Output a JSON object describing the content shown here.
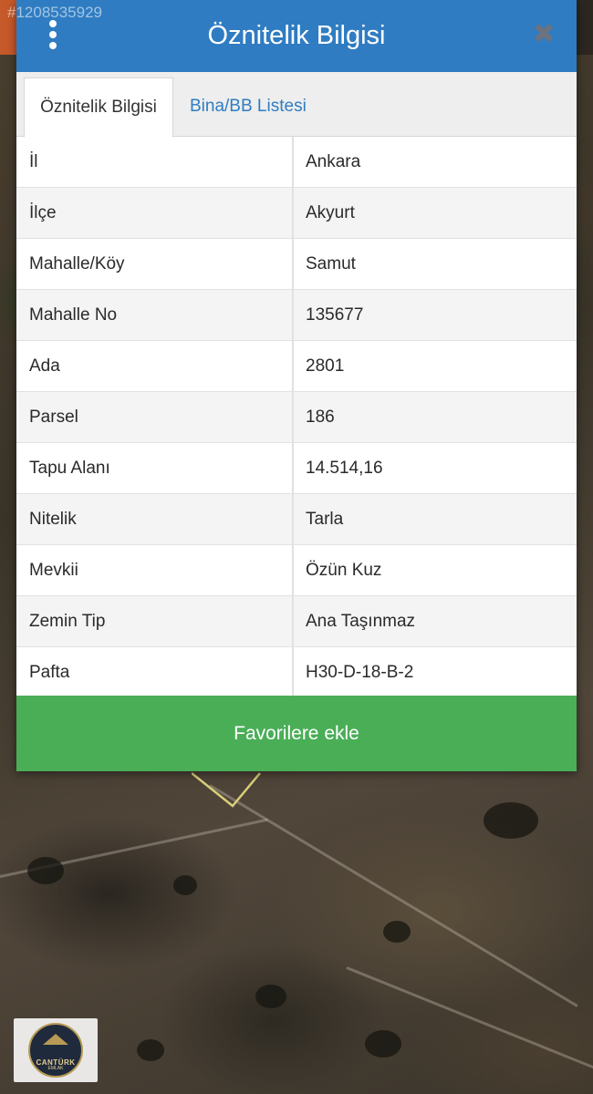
{
  "watermark": "#1208535929",
  "dialog": {
    "title": "Öznitelik Bilgisi",
    "menu_icon": "vertical-dots-icon",
    "close_icon": "close-icon"
  },
  "tabs": [
    {
      "label": "Öznitelik Bilgisi",
      "active": true
    },
    {
      "label": "Bina/BB Listesi",
      "active": false
    }
  ],
  "attributes": [
    {
      "key": "İl",
      "value": "Ankara"
    },
    {
      "key": "İlçe",
      "value": "Akyurt"
    },
    {
      "key": "Mahalle/Köy",
      "value": "Samut"
    },
    {
      "key": "Mahalle No",
      "value": "135677"
    },
    {
      "key": "Ada",
      "value": "2801"
    },
    {
      "key": "Parsel",
      "value": "186"
    },
    {
      "key": "Tapu Alanı",
      "value": "14.514,16"
    },
    {
      "key": "Nitelik",
      "value": "Tarla"
    },
    {
      "key": "Mevkii",
      "value": "Özün Kuz"
    },
    {
      "key": "Zemin Tip",
      "value": "Ana Taşınmaz"
    },
    {
      "key": "Pafta",
      "value": "H30-D-18-B-2"
    }
  ],
  "favorite_button": "Favorilere ekle",
  "logo": {
    "name": "CANTÜRK",
    "sub": "EMLAK"
  },
  "colors": {
    "header": "#2f7cc2",
    "tab_link": "#2f7cc2",
    "favorite": "#4aae57"
  }
}
